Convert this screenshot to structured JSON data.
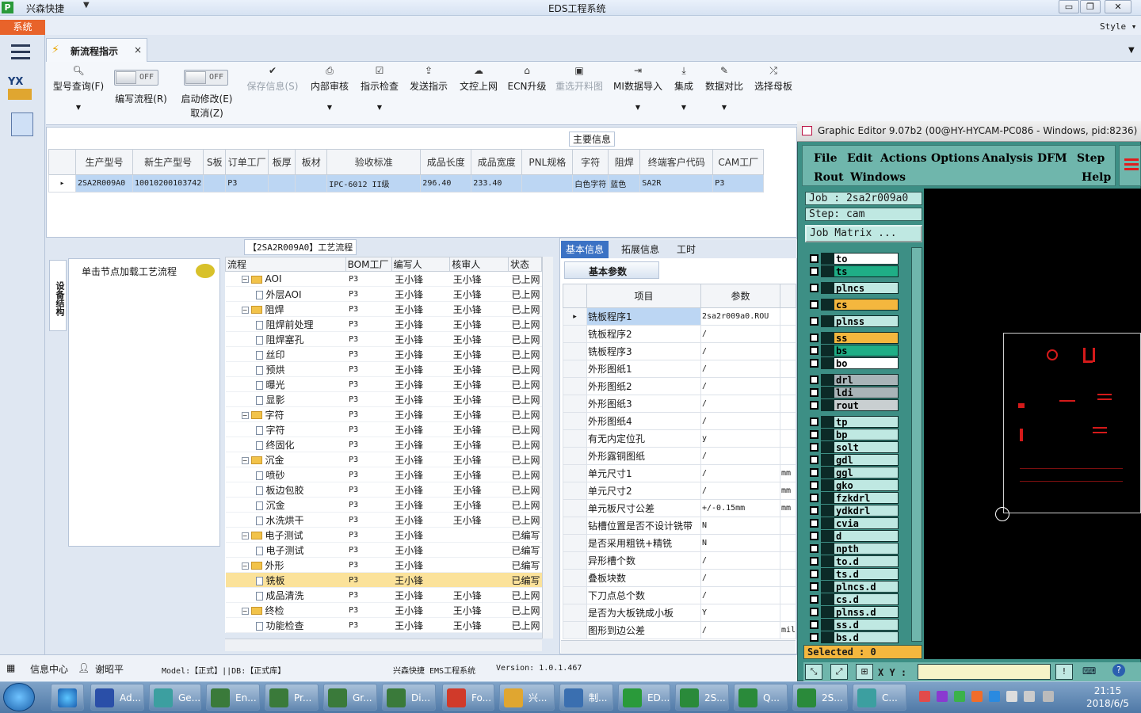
{
  "window": {
    "app_name": "兴森快捷",
    "title": "EDS工程系统",
    "system_tab": "系统",
    "style_label": "Style"
  },
  "winbtns": {
    "min": "▭",
    "max": "❐",
    "close": "✕"
  },
  "left": {
    "yx_label": "YX"
  },
  "doc_tab": {
    "label": "新流程指示",
    "close": "×"
  },
  "toolbar": {
    "model_query": "型号查询(F)",
    "edit_flow": "编写流程(R)",
    "toggle_off": "OFF",
    "start_modify": "启动修改(E)",
    "cancel": "取消(Z)",
    "save_info": "保存信息(S)",
    "internal_review": "内部审核",
    "indicator_check": "指示检查",
    "send_indicator": "发送指示",
    "upload_doc": "文控上网",
    "ecn_upgrade": "ECN升级",
    "reselect_chart": "重选开料图",
    "mi_import": "MI数据导入",
    "integrate": "集成",
    "data_compare": "数据对比",
    "select_mother": "选择母板"
  },
  "main_info": {
    "label": "主要信息",
    "columns": [
      "生产型号",
      "新生产型号",
      "S板",
      "订单工厂",
      "板厚",
      "板材",
      "验收标准",
      "成品长度",
      "成品宽度",
      "PNL规格",
      "字符",
      "阻焊",
      "终端客户代码",
      "CAM工厂"
    ],
    "row": [
      "2SA2R009A0",
      "10010200103742",
      "",
      "P3",
      "",
      "",
      "IPC-6012 II级",
      "296.40",
      "233.40",
      "",
      "白色字符",
      "蓝色",
      "SA2R",
      "P3"
    ]
  },
  "process": {
    "label": "【2SA2R009A0】工艺流程",
    "vtab": "设备结构",
    "hint": "单击节点加载工艺流程",
    "columns": [
      "流程",
      "BOM工厂",
      "编写人",
      "核审人",
      "状态"
    ],
    "rows": [
      {
        "kind": "folder",
        "name": "AOI",
        "bom": "P3",
        "writer": "王小锋",
        "reviewer": "王小锋",
        "status": "已上网"
      },
      {
        "kind": "leaf",
        "name": "外层AOI",
        "bom": "P3",
        "writer": "王小锋",
        "reviewer": "王小锋",
        "status": "已上网"
      },
      {
        "kind": "folder",
        "name": "阻焊",
        "bom": "P3",
        "writer": "王小锋",
        "reviewer": "王小锋",
        "status": "已上网"
      },
      {
        "kind": "leaf",
        "name": "阻焊前处理",
        "bom": "P3",
        "writer": "王小锋",
        "reviewer": "王小锋",
        "status": "已上网"
      },
      {
        "kind": "leaf",
        "name": "阻焊塞孔",
        "bom": "P3",
        "writer": "王小锋",
        "reviewer": "王小锋",
        "status": "已上网"
      },
      {
        "kind": "leaf",
        "name": "丝印",
        "bom": "P3",
        "writer": "王小锋",
        "reviewer": "王小锋",
        "status": "已上网"
      },
      {
        "kind": "leaf",
        "name": "预烘",
        "bom": "P3",
        "writer": "王小锋",
        "reviewer": "王小锋",
        "status": "已上网"
      },
      {
        "kind": "leaf",
        "name": "曝光",
        "bom": "P3",
        "writer": "王小锋",
        "reviewer": "王小锋",
        "status": "已上网"
      },
      {
        "kind": "leaf",
        "name": "显影",
        "bom": "P3",
        "writer": "王小锋",
        "reviewer": "王小锋",
        "status": "已上网"
      },
      {
        "kind": "folder",
        "name": "字符",
        "bom": "P3",
        "writer": "王小锋",
        "reviewer": "王小锋",
        "status": "已上网"
      },
      {
        "kind": "leaf",
        "name": "字符",
        "bom": "P3",
        "writer": "王小锋",
        "reviewer": "王小锋",
        "status": "已上网"
      },
      {
        "kind": "leaf",
        "name": "终固化",
        "bom": "P3",
        "writer": "王小锋",
        "reviewer": "王小锋",
        "status": "已上网"
      },
      {
        "kind": "folder",
        "name": "沉金",
        "bom": "P3",
        "writer": "王小锋",
        "reviewer": "王小锋",
        "status": "已上网"
      },
      {
        "kind": "leaf",
        "name": "喷砂",
        "bom": "P3",
        "writer": "王小锋",
        "reviewer": "王小锋",
        "status": "已上网"
      },
      {
        "kind": "leaf",
        "name": "板边包胶",
        "bom": "P3",
        "writer": "王小锋",
        "reviewer": "王小锋",
        "status": "已上网"
      },
      {
        "kind": "leaf",
        "name": "沉金",
        "bom": "P3",
        "writer": "王小锋",
        "reviewer": "王小锋",
        "status": "已上网"
      },
      {
        "kind": "leaf",
        "name": "水洗烘干",
        "bom": "P3",
        "writer": "王小锋",
        "reviewer": "王小锋",
        "status": "已上网"
      },
      {
        "kind": "folder",
        "name": "电子测试",
        "bom": "P3",
        "writer": "王小锋",
        "reviewer": "",
        "status": "已编写"
      },
      {
        "kind": "leaf",
        "name": "电子测试",
        "bom": "P3",
        "writer": "王小锋",
        "reviewer": "",
        "status": "已编写"
      },
      {
        "kind": "folder",
        "name": "外形",
        "bom": "P3",
        "writer": "王小锋",
        "reviewer": "",
        "status": "已编写"
      },
      {
        "kind": "leaf",
        "name": "铣板",
        "bom": "P3",
        "writer": "王小锋",
        "reviewer": "",
        "status": "已编写",
        "selected": true
      },
      {
        "kind": "leaf",
        "name": "成品清洗",
        "bom": "P3",
        "writer": "王小锋",
        "reviewer": "王小锋",
        "status": "已上网"
      },
      {
        "kind": "folder",
        "name": "终检",
        "bom": "P3",
        "writer": "王小锋",
        "reviewer": "王小锋",
        "status": "已上网"
      },
      {
        "kind": "leaf",
        "name": "功能检查",
        "bom": "P3",
        "writer": "王小锋",
        "reviewer": "王小锋",
        "status": "已上网"
      }
    ]
  },
  "basic_info": {
    "tabs": [
      "基本信息",
      "拓展信息",
      "工时"
    ],
    "subtab": "基本参数",
    "columns": [
      "项目",
      "参数"
    ],
    "rows": [
      {
        "item": "铣板程序1",
        "value": "2sa2r009a0.ROU",
        "unit": ""
      },
      {
        "item": "铣板程序2",
        "value": "/",
        "unit": ""
      },
      {
        "item": "铣板程序3",
        "value": "/",
        "unit": ""
      },
      {
        "item": "外形图纸1",
        "value": "/",
        "unit": ""
      },
      {
        "item": "外形图纸2",
        "value": "/",
        "unit": ""
      },
      {
        "item": "外形图纸3",
        "value": "/",
        "unit": ""
      },
      {
        "item": "外形图纸4",
        "value": "/",
        "unit": ""
      },
      {
        "item": "有无内定位孔",
        "value": "y",
        "unit": ""
      },
      {
        "item": "外形露铜图纸",
        "value": "/",
        "unit": ""
      },
      {
        "item": "单元尺寸1",
        "value": "/",
        "unit": "mm"
      },
      {
        "item": "单元尺寸2",
        "value": "/",
        "unit": "mm"
      },
      {
        "item": "单元板尺寸公差",
        "value": "+/-0.15mm",
        "unit": "mm"
      },
      {
        "item": "钻槽位置是否不设计铣带",
        "value": "N",
        "unit": ""
      },
      {
        "item": "是否采用粗铣+精铣",
        "value": "N",
        "unit": ""
      },
      {
        "item": "异形槽个数",
        "value": "/",
        "unit": ""
      },
      {
        "item": "叠板块数",
        "value": "/",
        "unit": ""
      },
      {
        "item": "下刀点总个数",
        "value": "/",
        "unit": ""
      },
      {
        "item": "是否为大板铣成小板",
        "value": "Y",
        "unit": ""
      },
      {
        "item": "图形到边公差",
        "value": "/",
        "unit": "mil"
      }
    ]
  },
  "statusbar": {
    "info_center": "信息中心",
    "user": "谢昭平",
    "model": "Model:【正式】||DB:【正式库】",
    "system": "兴森快捷 EMS工程系统",
    "version": "Version: 1.0.1.467"
  },
  "graphic_editor": {
    "title": "Graphic Editor 9.07b2 (00@HY-HYCAM-PC086 - Windows, pid:8236)",
    "menu": [
      "File",
      "Edit",
      "Actions",
      "Options",
      "Analysis",
      "DFM",
      "Step",
      "Rout",
      "Windows",
      "Help"
    ],
    "job": "Job : 2sa2r009a0",
    "step": "Step: cam",
    "job_matrix": "Job Matrix ...",
    "selected": "Selected : 0",
    "xy_label": "X Y :",
    "layers": [
      {
        "name": "to",
        "color": "#ffffff"
      },
      {
        "name": "ts",
        "color": "#1fae86"
      },
      {
        "name": "plncs",
        "color": "#bfe8e2"
      },
      {
        "name": "cs",
        "color": "#f4b73e"
      },
      {
        "name": "plnss",
        "color": "#bfe8e2"
      },
      {
        "name": "ss",
        "color": "#f4b73e"
      },
      {
        "name": "bs",
        "color": "#1fae86"
      },
      {
        "name": "bo",
        "color": "#ffffff"
      },
      {
        "name": "drl",
        "color": "#a9b4b8"
      },
      {
        "name": "ldi",
        "color": "#a9b4b8"
      },
      {
        "name": "rout",
        "color": "#c9cfd1"
      },
      {
        "name": "tp",
        "color": "#bfe8e2"
      },
      {
        "name": "bp",
        "color": "#bfe8e2"
      },
      {
        "name": "solt",
        "color": "#bfe8e2"
      },
      {
        "name": "gdl",
        "color": "#bfe8e2"
      },
      {
        "name": "ggl",
        "color": "#bfe8e2"
      },
      {
        "name": "gko",
        "color": "#bfe8e2"
      },
      {
        "name": "fzkdrl",
        "color": "#bfe8e2"
      },
      {
        "name": "ydkdrl",
        "color": "#bfe8e2"
      },
      {
        "name": "cvia",
        "color": "#bfe8e2"
      },
      {
        "name": "d",
        "color": "#bfe8e2"
      },
      {
        "name": "npth",
        "color": "#bfe8e2"
      },
      {
        "name": "to.d",
        "color": "#bfe8e2"
      },
      {
        "name": "ts.d",
        "color": "#bfe8e2"
      },
      {
        "name": "plncs.d",
        "color": "#bfe8e2"
      },
      {
        "name": "cs.d",
        "color": "#bfe8e2"
      },
      {
        "name": "plnss.d",
        "color": "#bfe8e2"
      },
      {
        "name": "ss.d",
        "color": "#bfe8e2"
      },
      {
        "name": "bs.d",
        "color": "#bfe8e2"
      }
    ]
  },
  "taskbar": {
    "items": [
      "Ad...",
      "Ge...",
      "En...",
      "Pr...",
      "Gr...",
      "Di...",
      "Fo...",
      "兴...",
      "制...",
      "ED...",
      "2S...",
      "Q...",
      "2S...",
      "C..."
    ],
    "time": "21:15",
    "date": "2018/6/5"
  }
}
